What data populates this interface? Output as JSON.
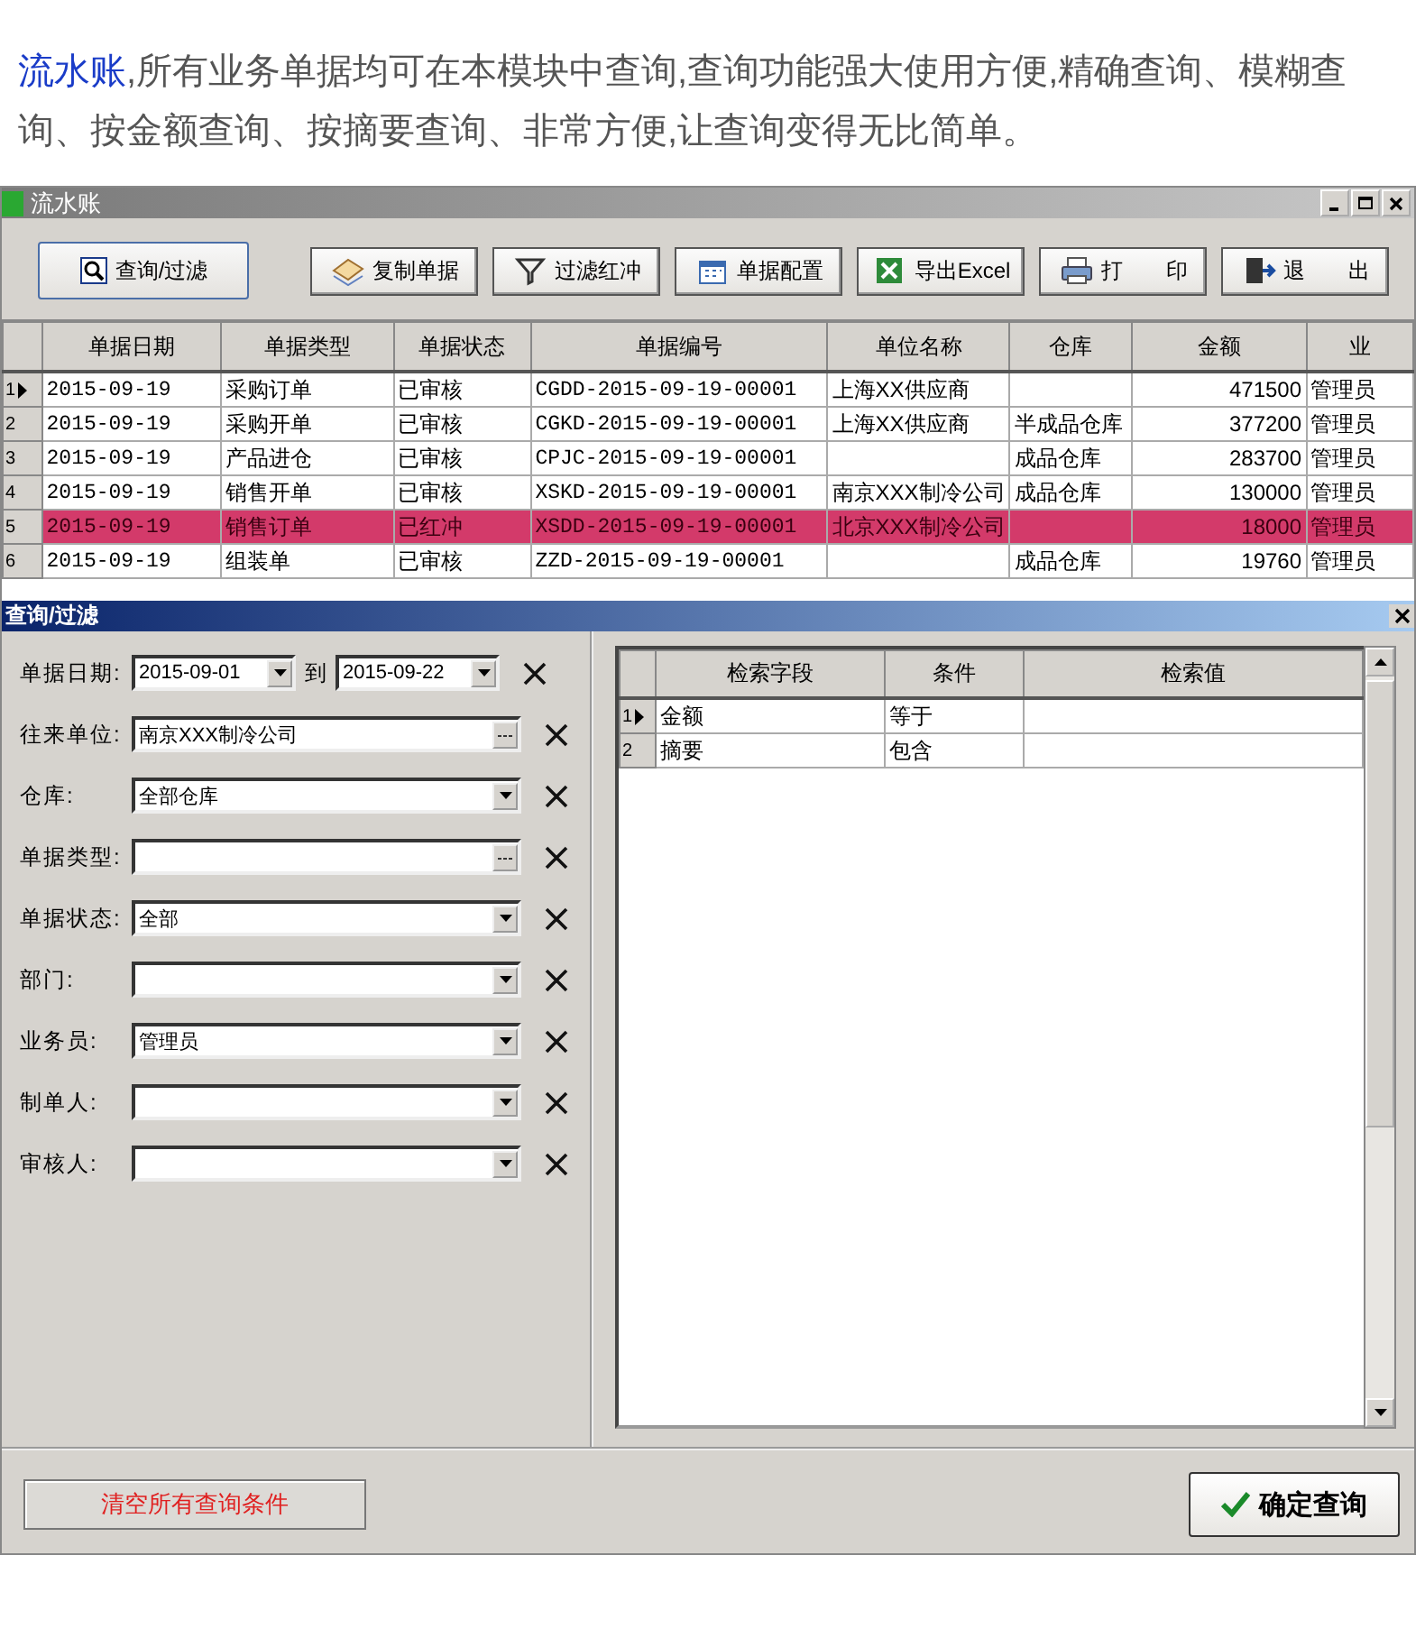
{
  "intro": {
    "term": "流水账",
    "text": ",所有业务单据均可在本模块中查询,查询功能强大使用方便,精确查询、模糊查询、按金额查询、按摘要查询、非常方便,让查询变得无比简单。"
  },
  "window": {
    "title": "流水账"
  },
  "toolbar": {
    "query_button": {
      "label": "查询/过滤"
    },
    "buttons": [
      {
        "kind": "copy",
        "label": "复制单据"
      },
      {
        "kind": "filter",
        "label": "过滤红冲"
      },
      {
        "kind": "config",
        "label": "单据配置"
      },
      {
        "kind": "excel",
        "label": "导出Excel"
      },
      {
        "kind": "print",
        "label": "打　　印"
      },
      {
        "kind": "exit",
        "label": "退　　出"
      }
    ]
  },
  "table": {
    "columns": [
      "单据日期",
      "单据类型",
      "单据状态",
      "单据编号",
      "单位名称",
      "仓库",
      "金额",
      "业"
    ],
    "rows": [
      {
        "number": "1",
        "current": true,
        "highlighted": false,
        "cells": [
          "2015-09-19",
          "采购订单",
          "已审核",
          "CGDD-2015-09-19-00001",
          "上海XX供应商",
          "",
          "471500",
          "管理员"
        ]
      },
      {
        "number": "2",
        "current": false,
        "highlighted": false,
        "cells": [
          "2015-09-19",
          "采购开单",
          "已审核",
          "CGKD-2015-09-19-00001",
          "上海XX供应商",
          "半成品仓库",
          "377200",
          "管理员"
        ]
      },
      {
        "number": "3",
        "current": false,
        "highlighted": false,
        "cells": [
          "2015-09-19",
          "产品进仓",
          "已审核",
          "CPJC-2015-09-19-00001",
          "",
          "成品仓库",
          "283700",
          "管理员"
        ]
      },
      {
        "number": "4",
        "current": false,
        "highlighted": false,
        "cells": [
          "2015-09-19",
          "销售开单",
          "已审核",
          "XSKD-2015-09-19-00001",
          "南京XXX制冷公司",
          "成品仓库",
          "130000",
          "管理员"
        ]
      },
      {
        "number": "5",
        "current": false,
        "highlighted": true,
        "cells": [
          "2015-09-19",
          "销售订单",
          "已红冲",
          "XSDD-2015-09-19-00001",
          "北京XXX制冷公司",
          "",
          "18000",
          "管理员"
        ]
      },
      {
        "number": "6",
        "current": false,
        "highlighted": false,
        "cells": [
          "2015-09-19",
          "组装单",
          "已审核",
          "ZZD-2015-09-19-00001",
          "",
          "成品仓库",
          "19760",
          "管理员"
        ]
      }
    ]
  },
  "filter_panel": {
    "title": "查询/过滤",
    "fields": [
      {
        "kind": "date-range",
        "label": "单据日期:",
        "value": "2015-09-01",
        "to_label": "到",
        "value_to": "2015-09-22"
      },
      {
        "kind": "lookup",
        "label": "往来单位:",
        "value": "南京XXX制冷公司"
      },
      {
        "kind": "dropdown",
        "label": "仓库:",
        "value": "全部仓库"
      },
      {
        "kind": "lookup",
        "label": "单据类型:"
      },
      {
        "kind": "dropdown",
        "label": "单据状态:",
        "value": "全部"
      },
      {
        "kind": "dropdown",
        "label": "部门:"
      },
      {
        "kind": "dropdown",
        "label": "业务员:",
        "value": "管理员"
      },
      {
        "kind": "dropdown",
        "label": "制单人:"
      },
      {
        "kind": "dropdown",
        "label": "审核人:"
      }
    ],
    "search_grid": {
      "columns": [
        "检索字段",
        "条件",
        "检索值"
      ],
      "rows": [
        {
          "number": "1",
          "current": true,
          "cells": [
            "金额",
            "等于",
            ""
          ]
        },
        {
          "number": "2",
          "current": false,
          "cells": [
            "摘要",
            "包含",
            ""
          ]
        }
      ]
    },
    "clear_button": {
      "label": "清空所有查询条件"
    },
    "confirm_button": {
      "label": "确定查询"
    }
  }
}
